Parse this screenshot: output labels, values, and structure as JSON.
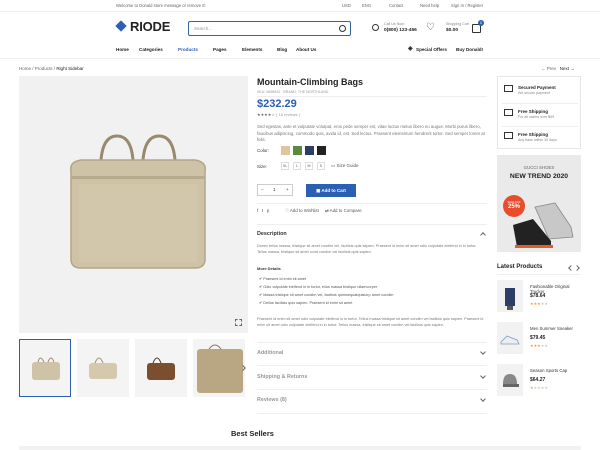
{
  "topbar": {
    "welcome": "Welcome to Donald store message or remove it!",
    "currency": "USD",
    "language": "ENG",
    "contact": "Contact",
    "help": "Need help",
    "signin": "Sign In / Register"
  },
  "header": {
    "logo": "RIODE",
    "search_placeholder": "Search...",
    "call_label": "Call Us Now:",
    "phone": "0(800) 123-456",
    "cart_label": "Shopping Cart",
    "cart_total": "$0.00",
    "cart_count": "0"
  },
  "nav": {
    "items": [
      "Home",
      "Categories",
      "Products",
      "Pages",
      "Elements",
      "Blog",
      "About Us"
    ],
    "special": "Special Offers",
    "buy": "Buy Donald!"
  },
  "breadcrumb": {
    "home": "Home",
    "products": "Products",
    "current": "Right Sidebar"
  },
  "pager": {
    "prev": "Prev",
    "next": "Next"
  },
  "product": {
    "title": "Mountain-Climbing Bags",
    "sku": "SKU: 5698632",
    "brand": "BRAND: THE NORTHLAND",
    "price": "$232.29",
    "reviews": "( 16 reviews )",
    "description": "Sed egestas, ante et vulputate volutpat, eros pede semper est, vitae luctus metus libero eu augue. Morbi purus libero, faucibus adipiscing, commodo quis, avida id, est. Sed lectus. Praesent elementum hendrerit tortor. Sed semper lorem at felis.",
    "color_label": "Color:",
    "size_label": "Size:",
    "sizes": [
      "XL",
      "L",
      "M",
      "S"
    ],
    "size_guide": "Size Guide",
    "qty": "1",
    "add_to_cart": "Add to Cart",
    "wishlist": "Add to Wishlist",
    "compare": "Add to Compare"
  },
  "tabs": {
    "description": "Description",
    "desc_text": "Donec tellus massa, tristique sit amet condim vel, facilisis quis sapien. Praesent id enim sit amet odio vulputate eleifend in in tortor. Tellus massa, tristique sit amet cond condim vel facilisis quis sapien.",
    "more_details": "More Details",
    "details": [
      "Praesent id enim sit amet",
      "Odio vulputate eleifend in in tortor, ellus massa tristique ullamcorper",
      "Massa tristique sit amet condim vel, facilisis quimsequatquislorp amet condim",
      "Dellus facilisis quis sapien. Praesent id enim sit amet"
    ],
    "desc_text2": "Praesent id enim sit amet odio vulputate eleifend in in tortor. Tellus massa tristique sit amet condim vel facilisis quis sapien. Praesent id enim sit amet odio vulputate eleifend in in tortor. Tellus massa, tristique sit amet condim vel facilisis quis sapien.",
    "additional": "Additional",
    "shipping": "Shipping & Returns",
    "reviews": "Reviews (8)"
  },
  "sidebar": {
    "features": [
      {
        "title": "Secured Payment",
        "sub": "We secure payment"
      },
      {
        "title": "Free Shipping",
        "sub": "For all orders over $99"
      },
      {
        "title": "Free Shipping",
        "sub": "Any base within 30 days"
      }
    ],
    "banner_top": "GUCCI SHOES",
    "banner_title": "NEW TREND 2020",
    "banner_badge": "SALE OFF",
    "banner_pct": "25%",
    "latest_title": "Latest Products",
    "products": [
      {
        "name": "Fashionable Original Trucker",
        "price": "$78.64"
      },
      {
        "name": "Men Summer Sneaker",
        "price": "$79.45"
      },
      {
        "name": "Season Sports Cap",
        "price": "$64.27"
      }
    ]
  },
  "bestsellers": "Best Sellers",
  "colors": {
    "accent": "#2b5fb4",
    "swatch1": "#e0c49c",
    "swatch2": "#5a8a3c",
    "swatch3": "#2c3e66",
    "swatch4": "#222222"
  }
}
